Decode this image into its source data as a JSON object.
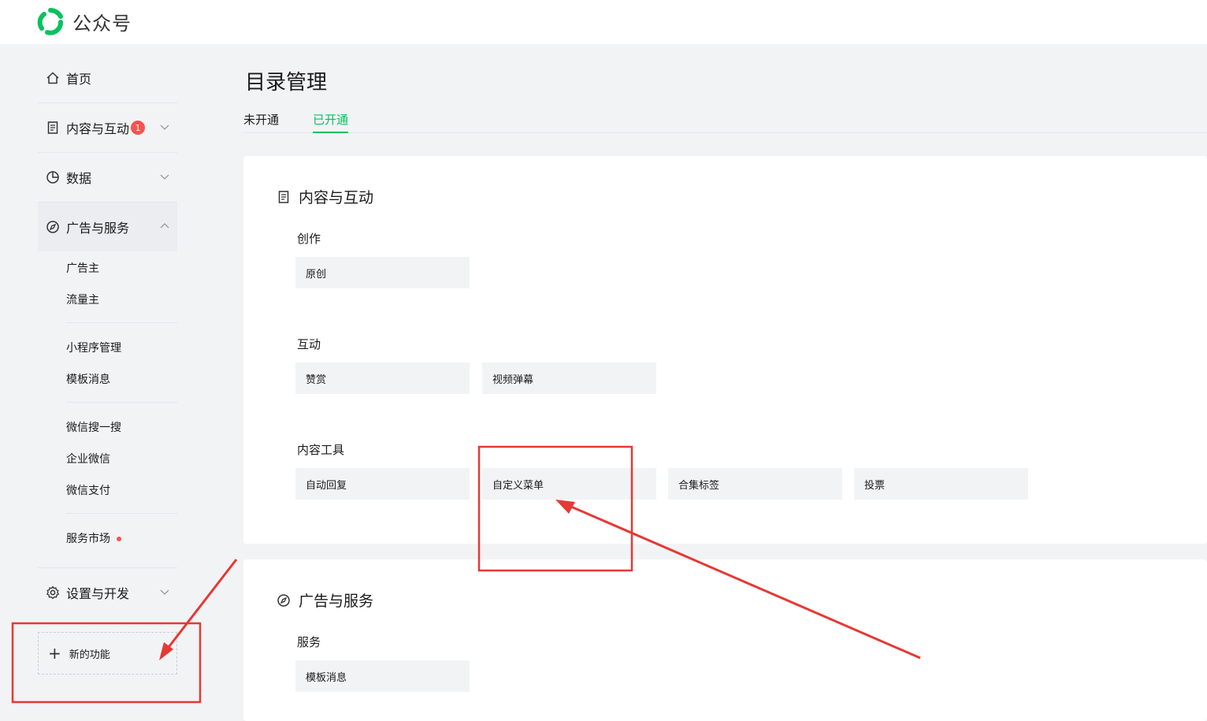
{
  "header": {
    "title": "公众号"
  },
  "sidebar": {
    "items": [
      {
        "label": "首页"
      },
      {
        "label": "内容与互动",
        "badge": "1"
      },
      {
        "label": "数据"
      },
      {
        "label": "广告与服务"
      },
      {
        "label": "设置与开发"
      }
    ],
    "ad_service_sub": [
      "广告主",
      "流量主",
      "小程序管理",
      "模板消息",
      "微信搜一搜",
      "企业微信",
      "微信支付",
      "服务市场"
    ],
    "new_feature": "新的功能"
  },
  "main": {
    "title": "目录管理",
    "tabs": [
      {
        "label": "未开通"
      },
      {
        "label": "已开通"
      }
    ],
    "active_tab": "已开通",
    "sections": [
      {
        "title": "内容与互动",
        "groups": [
          {
            "label": "创作",
            "tiles": [
              "原创"
            ]
          },
          {
            "label": "互动",
            "tiles": [
              "赞赏",
              "视频弹幕"
            ]
          },
          {
            "label": "内容工具",
            "tiles": [
              "自动回复",
              "自定义菜单",
              "合集标签",
              "投票"
            ]
          }
        ]
      },
      {
        "title": "广告与服务",
        "groups": [
          {
            "label": "服务",
            "tiles": [
              "模板消息"
            ]
          }
        ]
      }
    ]
  },
  "colors": {
    "accent": "#07c160",
    "badge": "#fa5151",
    "annotation": "#e53935"
  },
  "icons": [
    "wechat-logo-icon",
    "home-icon",
    "document-icon",
    "pie-chart-icon",
    "compass-icon",
    "gear-icon",
    "chevron-down-icon",
    "chevron-up-icon",
    "plus-icon"
  ]
}
